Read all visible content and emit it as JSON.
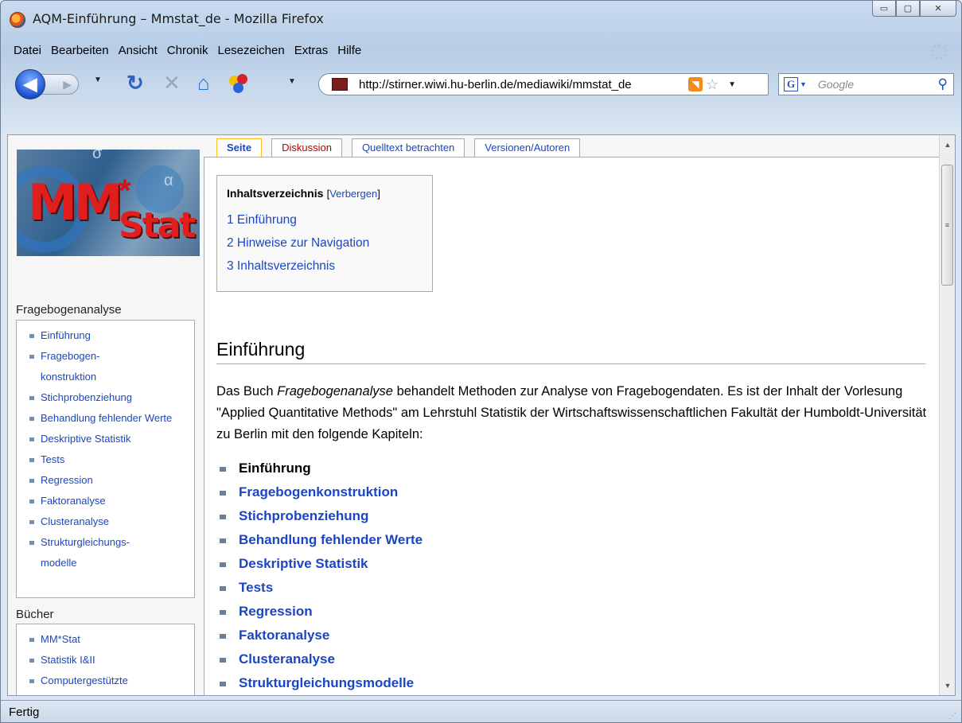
{
  "window": {
    "title": "AQM-Einführung – Mmstat_de - Mozilla Firefox",
    "buttons": {
      "minimize": "▭",
      "maximize": "▢",
      "close": "✕"
    }
  },
  "menu": [
    "Datei",
    "Bearbeiten",
    "Ansicht",
    "Chronik",
    "Lesezeichen",
    "Extras",
    "Hilfe"
  ],
  "toolbar": {
    "url": "http://stirner.wiwi.hu-berlin.de/mediawiki/mmstat_de",
    "search_placeholder": "Google",
    "search_engine": "G",
    "icons": [
      "back-icon",
      "forward-icon",
      "reload-icon",
      "stop-icon",
      "home-icon",
      "addon-icon",
      "rss-icon",
      "star-icon",
      "search-icon"
    ]
  },
  "sidebar": {
    "section1": {
      "title": "Fragebogenanalyse",
      "items": [
        "Einführung",
        "Fragebogen-\nkonstruktion",
        "Stichprobenziehung",
        "Behandlung fehlender Werte",
        "Deskriptive Statistik",
        "Tests",
        "Regression",
        "Faktoranalyse",
        "Clusteranalyse",
        "Strukturgleichungs-\nmodelle"
      ]
    },
    "section2": {
      "title": "Bücher",
      "items": [
        "MM*Stat",
        "Statistik I&II",
        "Computergestützte"
      ]
    }
  },
  "tabs": [
    {
      "label": "Seite",
      "state": "active"
    },
    {
      "label": "Diskussion",
      "state": "new"
    },
    {
      "label": "Quelltext betrachten",
      "state": ""
    },
    {
      "label": "Versionen/Autoren",
      "state": ""
    }
  ],
  "toc": {
    "title": "Inhaltsverzeichnis",
    "toggle_open": "[",
    "toggle_label": "Verbergen",
    "toggle_close": "]",
    "items": [
      "1 Einführung",
      "2 Hinweise zur Navigation",
      "3 Inhaltsverzeichnis"
    ]
  },
  "article": {
    "heading": "Einführung",
    "para_before": "Das Buch ",
    "para_em": "Fragebogenanalyse",
    "para_after": " behandelt Methoden zur Analyse von Fragebogendaten. Es ist der Inhalt der Vorlesung \"Applied Quantitative Methods\" am Lehrstuhl Statistik der Wirtschaftswissenschaftlichen Fakultät der Humboldt-Universität zu Berlin mit den folgende Kapiteln:",
    "chapters": [
      "Einführung",
      "Fragebogenkonstruktion",
      "Stichprobenziehung",
      "Behandlung fehlender Werte",
      "Deskriptive Statistik",
      "Tests",
      "Regression",
      "Faktoranalyse",
      "Clusteranalyse",
      "Strukturgleichungsmodelle"
    ]
  },
  "status": "Fertig",
  "colors": {
    "link": "#1a46c6",
    "new_link": "#ba0000",
    "active_tab_border": "#fabd23"
  }
}
